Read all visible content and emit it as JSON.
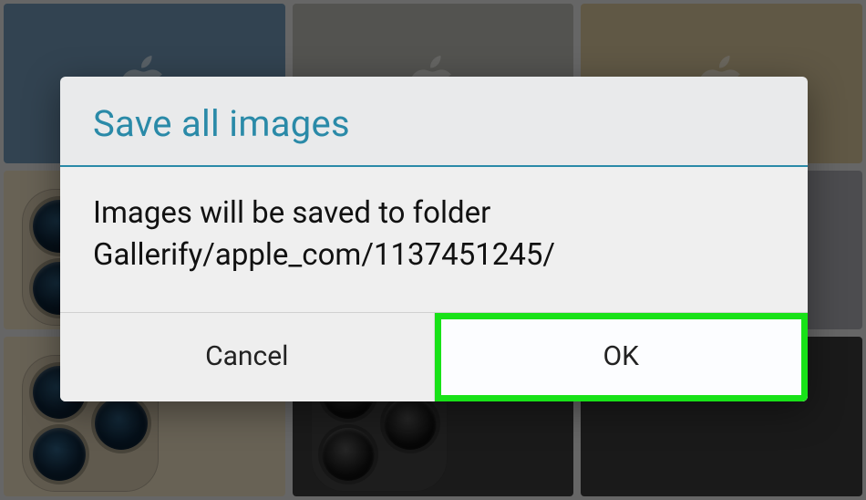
{
  "dialog": {
    "title": "Save all images",
    "message": "Images will be saved to folder Gallerify/apple_com/1137451245/",
    "cancel_label": "Cancel",
    "ok_label": "OK"
  },
  "colors": {
    "accent": "#2a8aa8",
    "highlight": "#18e218"
  },
  "background": {
    "tiles": [
      "blue",
      "gray",
      "gold",
      "champ-phone",
      "dark-phone",
      "silver-phone",
      "champ-phone",
      "dark-phone",
      "dark"
    ],
    "icon": "apple-logo-icon"
  }
}
